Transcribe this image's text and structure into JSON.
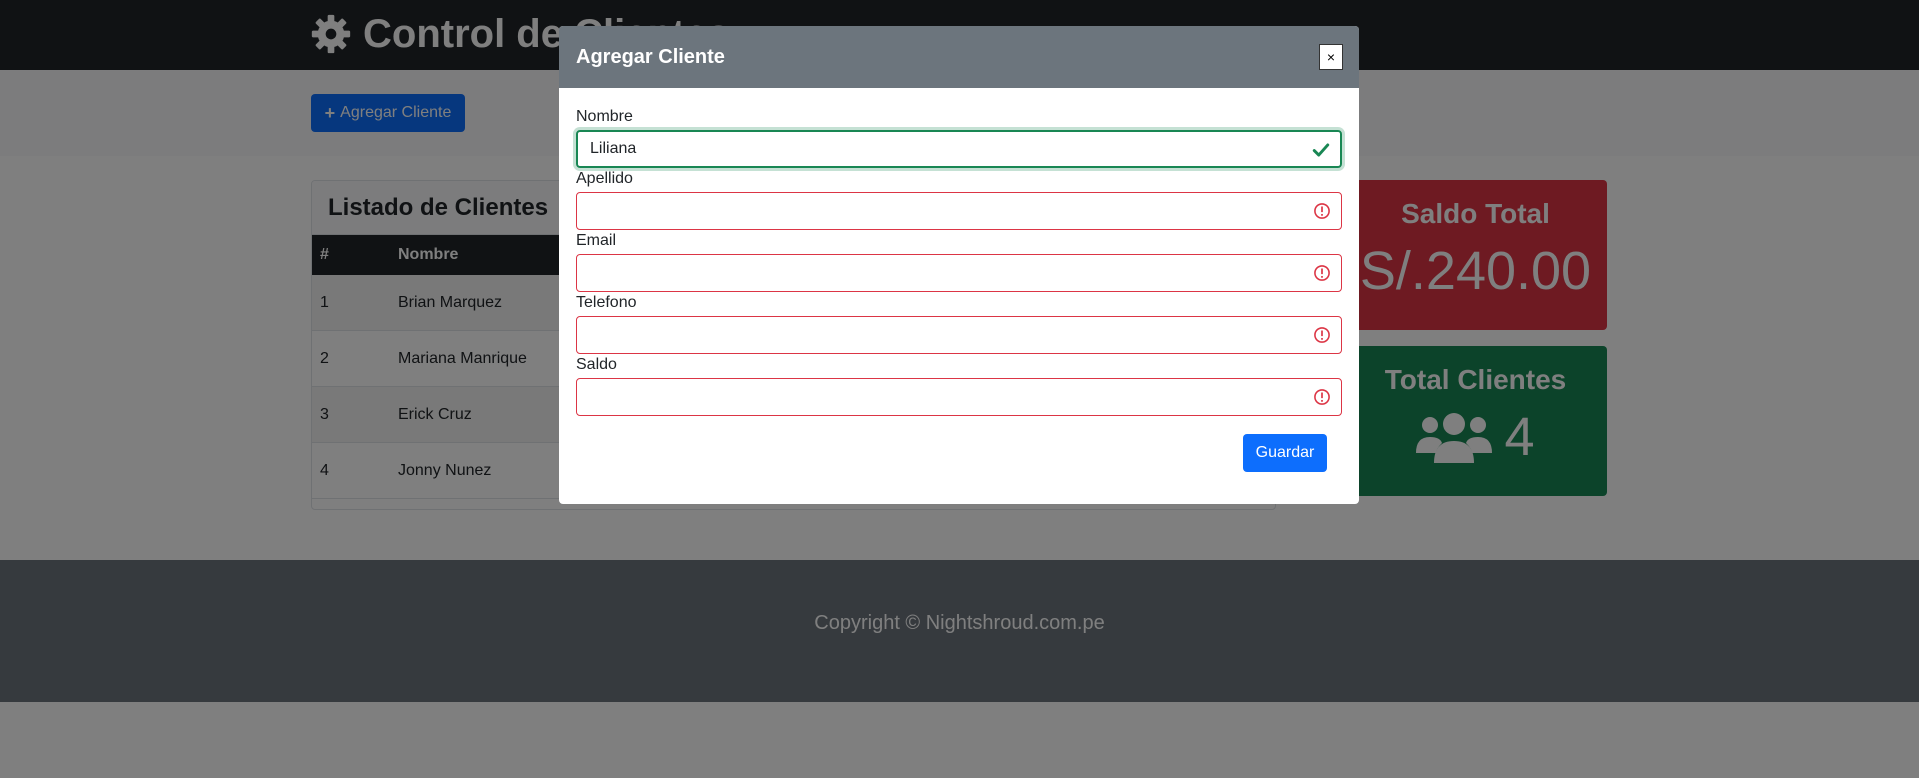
{
  "header": {
    "title": "Control de Clientes"
  },
  "actions": {
    "add_client_label": "Agregar Cliente"
  },
  "clients": {
    "title": "Listado de Clientes",
    "columns": [
      "#",
      "Nombre"
    ],
    "rows": [
      {
        "num": "1",
        "name": "Brian Marquez"
      },
      {
        "num": "2",
        "name": "Mariana Manrique"
      },
      {
        "num": "3",
        "name": "Erick Cruz"
      },
      {
        "num": "4",
        "name": "Jonny Nunez"
      }
    ]
  },
  "summary": {
    "saldo_title": "Saldo Total",
    "saldo_value": "S/.240.00",
    "clientes_title": "Total Clientes",
    "clientes_value": "4"
  },
  "footer": {
    "copyright": "Copyright © Nightshroud.com.pe"
  },
  "modal": {
    "title": "Agregar Cliente",
    "close_label": "×",
    "fields": {
      "nombre": {
        "label": "Nombre",
        "value": "Liliana",
        "state": "valid"
      },
      "apellido": {
        "label": "Apellido",
        "value": "",
        "state": "invalid"
      },
      "email": {
        "label": "Email",
        "value": "",
        "state": "invalid"
      },
      "telefono": {
        "label": "Telefono",
        "value": "",
        "state": "invalid"
      },
      "saldo": {
        "label": "Saldo",
        "value": "",
        "state": "invalid"
      }
    },
    "save_label": "Guardar"
  },
  "colors": {
    "header_bg": "#212529",
    "primary": "#0d6efd",
    "danger": "#dc3545",
    "success": "#198754",
    "footer_bg": "#6c757d"
  },
  "icons": {
    "header": "gear-icon",
    "add_button": "plus-icon",
    "clientes_card": "users-icon",
    "valid_field": "check-icon",
    "invalid_field": "exclamation-circle-icon"
  }
}
